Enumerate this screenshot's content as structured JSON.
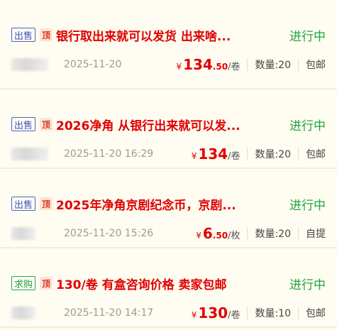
{
  "listings": [
    {
      "tag": "出售",
      "tag_type": "sell",
      "top": "顶",
      "title": "银行取出来就可以发货 出来啥...",
      "status": "进行中",
      "time": "2025-11-20",
      "currency": "¥",
      "price": "134",
      "price_decimal": ".50",
      "unit": "/卷",
      "quantity": "数量:20",
      "shipping": "包邮"
    },
    {
      "tag": "出售",
      "tag_type": "sell",
      "top": "顶",
      "title": "2026净角 从银行出来就可以发...",
      "status": "进行中",
      "time": "2025-11-20 16:29",
      "currency": "¥",
      "price": "134",
      "price_decimal": "",
      "unit": "/卷",
      "quantity": "数量:20",
      "shipping": "包邮"
    },
    {
      "tag": "出售",
      "tag_type": "sell",
      "top": "顶",
      "title": "2025年净角京剧纪念币，京剧...",
      "status": "进行中",
      "time": "2025-11-20 15:26",
      "currency": "¥",
      "price": "6",
      "price_decimal": ".50",
      "unit": "/枚",
      "quantity": "数量:20",
      "shipping": "自提"
    },
    {
      "tag": "求购",
      "tag_type": "buy",
      "top": "顶",
      "title": "130/卷 有盒咨询价格 卖家包邮",
      "status": "进行中",
      "time": "2025-11-20 14:17",
      "currency": "¥",
      "price": "130",
      "price_decimal": "",
      "unit": "/卷",
      "quantity": "数量:10",
      "shipping": "包邮"
    }
  ],
  "colors": {
    "background": "#fffbef",
    "title_red": "#e00000",
    "status_green": "#21a33e",
    "sell_tag_blue": "#3f56c4",
    "buy_tag_green": "#1ea24a"
  }
}
